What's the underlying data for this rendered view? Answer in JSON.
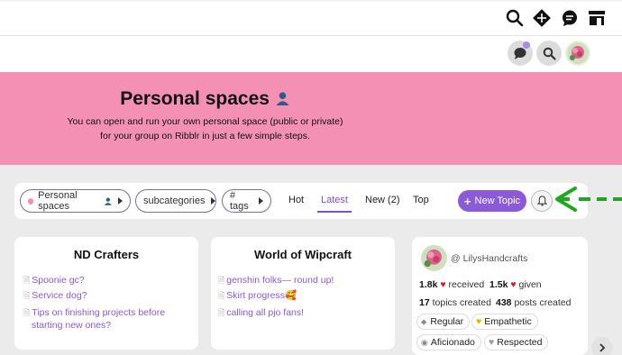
{
  "banner": {
    "title": "Personal spaces",
    "line1": "You can open and run your own personal space (public or private)",
    "line2": "for your group on Ribblr in just a few simple steps."
  },
  "nav": {
    "category": "Personal spaces",
    "subcategories": "subcategories",
    "tags": "# tags",
    "tabs": [
      "Hot",
      "Latest",
      "New (2)",
      "Top"
    ],
    "new_topic": "New Topic"
  },
  "cards": [
    {
      "title": "ND Crafters",
      "topics": [
        "Spoonie gc?",
        "Service dog?",
        "Tips on finishing projects before",
        "starting new ones?"
      ]
    },
    {
      "title": "World of Wipcraft",
      "topics": [
        "genshin folks— round up!",
        "Skirt progress🥰",
        "calling all pjo fans!"
      ]
    }
  ],
  "user_card": {
    "username": "@ LilysHandcrafts",
    "received_count": "1.8k",
    "received_label": "received",
    "given_count": "1.5k",
    "given_label": "given",
    "topics_count": "17",
    "topics_label": "topics created",
    "posts_count": "438",
    "posts_label": "posts created",
    "badges": [
      "Regular",
      "Empathetic",
      "Aficionado",
      "Respected"
    ]
  },
  "colors": {
    "accent": "#8a5ad9",
    "banner": "#f590b5",
    "arrow": "#1fa81f"
  }
}
